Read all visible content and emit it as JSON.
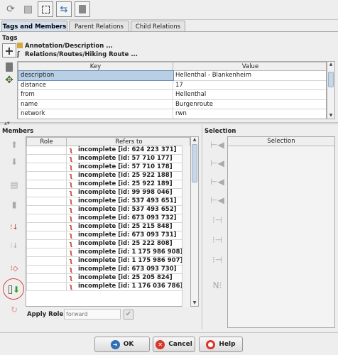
{
  "toolbar": {
    "buttons": [
      {
        "icon": "refresh-icon",
        "glyph": "⟳"
      },
      {
        "icon": "save-icon",
        "glyph": "■"
      },
      {
        "icon": "select-icon",
        "glyph": "⬚"
      },
      {
        "icon": "zoom-icon",
        "glyph": "⇆"
      },
      {
        "icon": "trash-icon",
        "glyph": "🗑"
      }
    ]
  },
  "tabs": [
    {
      "label": "Tags and Members",
      "active": true
    },
    {
      "label": "Parent Relations",
      "active": false
    },
    {
      "label": "Child Relations",
      "active": false
    }
  ],
  "tags": {
    "title": "Tags",
    "presets": [
      "Annotation/Description ...",
      "Relations/Routes/Hiking Route ..."
    ],
    "columns": [
      "Key",
      "Value"
    ],
    "rows": [
      {
        "key": "description",
        "value": "Hellenthal - Blankenheim"
      },
      {
        "key": "distance",
        "value": "17"
      },
      {
        "key": "from",
        "value": "Hellenthal"
      },
      {
        "key": "name",
        "value": "Burgenroute"
      },
      {
        "key": "network",
        "value": "rwn"
      }
    ]
  },
  "members": {
    "title": "Members",
    "columns": [
      "Role",
      "Refers to"
    ],
    "rows": [
      "incomplete [id: 624 223 371]",
      "incomplete [id: 57 710 177]",
      "incomplete [id: 57 710 178]",
      "incomplete [id: 25 922 188]",
      "incomplete [id: 25 922 189]",
      "incomplete [id: 99 998 046]",
      "incomplete [id: 537 493 651]",
      "incomplete [id: 537 493 652]",
      "incomplete [id: 673 093 732]",
      "incomplete [id: 25 215 848]",
      "incomplete [id: 673 093 731]",
      "incomplete [id: 25 222 808]",
      "incomplete [id: 1 175 986 908]",
      "incomplete [id: 1 175 986 907]",
      "incomplete [id: 673 093 730]",
      "incomplete [id: 25 205 824]",
      "incomplete [id: 1 176 036 786]"
    ],
    "apply_role_label": "Apply Role:",
    "apply_role_placeholder": "forward"
  },
  "selection": {
    "title": "Selection",
    "column": "Selection"
  },
  "buttons": {
    "ok": "OK",
    "cancel": "Cancel",
    "help": "Help"
  },
  "colors": {
    "tab_active": "#d4e1f0",
    "selected_cell": "#b8cfe5",
    "ok_icon": "#2f6fb5",
    "cancel_icon": "#d9362b",
    "help_icon": "#d9362b",
    "highlight_circle": "#e0403a"
  }
}
